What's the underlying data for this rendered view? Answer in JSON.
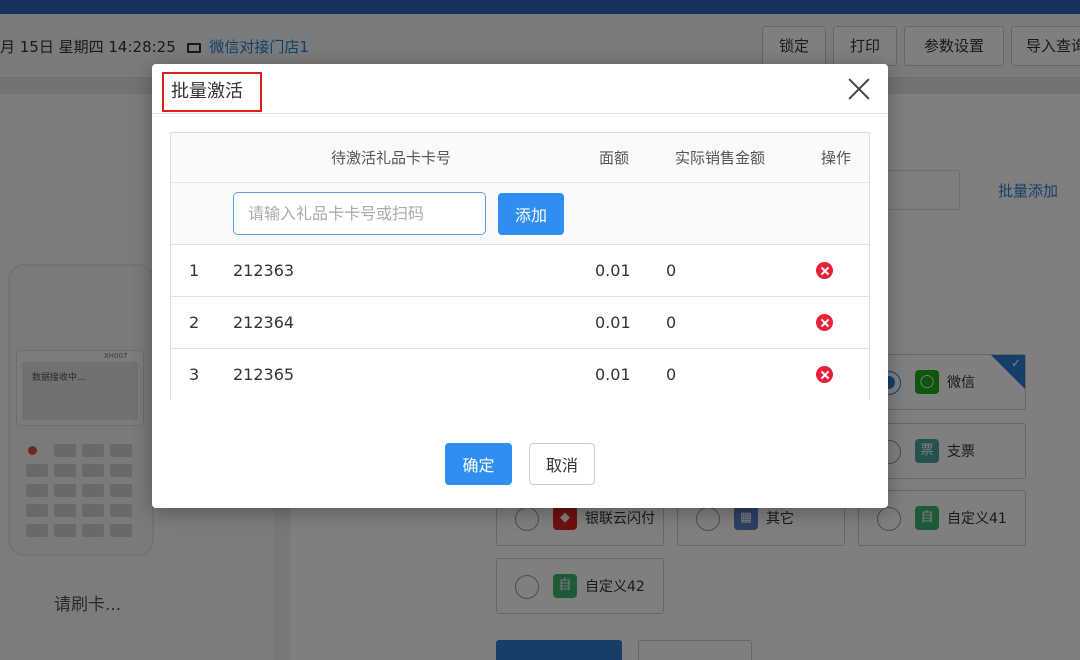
{
  "header": {
    "date_text": "月 15日  星期四  14:28:25",
    "store_name": "微信对接门店1",
    "buttons": [
      "锁定",
      "打印",
      "参数设置",
      "导入查询"
    ]
  },
  "terminal": {
    "model": "XH007",
    "screen_text": "数据接收中..."
  },
  "left": {
    "swipe_prompt": "请刷卡..."
  },
  "right": {
    "batch_add_link": "批量添加",
    "payment_methods": [
      {
        "label": "微信",
        "icon": "wechat-icon",
        "color": "#1aad19",
        "selected": true
      },
      {
        "label": "支票",
        "icon": "check-icon",
        "color": "#4aa3a3",
        "selected": false
      },
      {
        "label": "银联云闪付",
        "icon": "unionpay-icon",
        "color": "#e02020",
        "selected": false
      },
      {
        "label": "其它",
        "icon": "other-icon",
        "color": "#5b7fc4",
        "selected": false
      },
      {
        "label": "自定义41",
        "icon": "custom-icon",
        "color": "#3cb371",
        "selected": false
      },
      {
        "label": "自定义42",
        "icon": "custom-icon",
        "color": "#3cb371",
        "selected": false
      }
    ],
    "custom_icon_glyph": "自"
  },
  "modal": {
    "title": "批量激活",
    "columns": [
      "待激活礼品卡卡号",
      "面额",
      "实际销售金额",
      "操作"
    ],
    "input_placeholder": "请输入礼品卡卡号或扫码",
    "add_label": "添加",
    "rows": [
      {
        "index": "1",
        "card_no": "212363",
        "face_value": "0.01",
        "sale_amount": "0"
      },
      {
        "index": "2",
        "card_no": "212364",
        "face_value": "0.01",
        "sale_amount": "0"
      },
      {
        "index": "3",
        "card_no": "212365",
        "face_value": "0.01",
        "sale_amount": "0"
      }
    ],
    "confirm_label": "确定",
    "cancel_label": "取消"
  },
  "colors": {
    "accent": "#2f8ef0",
    "danger": "#e8213a",
    "header_bar": "#2a63b8"
  }
}
